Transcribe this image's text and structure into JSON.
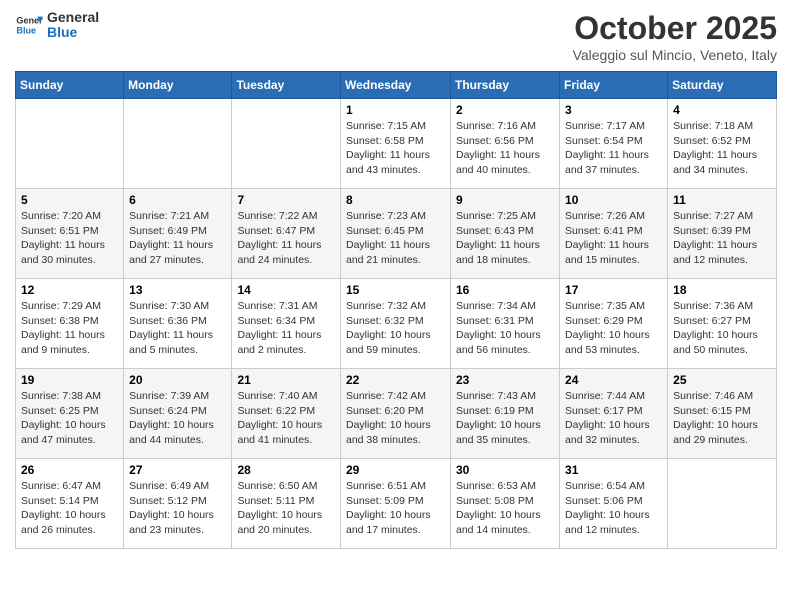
{
  "header": {
    "logo_general": "General",
    "logo_blue": "Blue",
    "month_title": "October 2025",
    "location": "Valeggio sul Mincio, Veneto, Italy"
  },
  "days_of_week": [
    "Sunday",
    "Monday",
    "Tuesday",
    "Wednesday",
    "Thursday",
    "Friday",
    "Saturday"
  ],
  "weeks": [
    [
      {
        "day": "",
        "info": ""
      },
      {
        "day": "",
        "info": ""
      },
      {
        "day": "",
        "info": ""
      },
      {
        "day": "1",
        "info": "Sunrise: 7:15 AM\nSunset: 6:58 PM\nDaylight: 11 hours and 43 minutes."
      },
      {
        "day": "2",
        "info": "Sunrise: 7:16 AM\nSunset: 6:56 PM\nDaylight: 11 hours and 40 minutes."
      },
      {
        "day": "3",
        "info": "Sunrise: 7:17 AM\nSunset: 6:54 PM\nDaylight: 11 hours and 37 minutes."
      },
      {
        "day": "4",
        "info": "Sunrise: 7:18 AM\nSunset: 6:52 PM\nDaylight: 11 hours and 34 minutes."
      }
    ],
    [
      {
        "day": "5",
        "info": "Sunrise: 7:20 AM\nSunset: 6:51 PM\nDaylight: 11 hours and 30 minutes."
      },
      {
        "day": "6",
        "info": "Sunrise: 7:21 AM\nSunset: 6:49 PM\nDaylight: 11 hours and 27 minutes."
      },
      {
        "day": "7",
        "info": "Sunrise: 7:22 AM\nSunset: 6:47 PM\nDaylight: 11 hours and 24 minutes."
      },
      {
        "day": "8",
        "info": "Sunrise: 7:23 AM\nSunset: 6:45 PM\nDaylight: 11 hours and 21 minutes."
      },
      {
        "day": "9",
        "info": "Sunrise: 7:25 AM\nSunset: 6:43 PM\nDaylight: 11 hours and 18 minutes."
      },
      {
        "day": "10",
        "info": "Sunrise: 7:26 AM\nSunset: 6:41 PM\nDaylight: 11 hours and 15 minutes."
      },
      {
        "day": "11",
        "info": "Sunrise: 7:27 AM\nSunset: 6:39 PM\nDaylight: 11 hours and 12 minutes."
      }
    ],
    [
      {
        "day": "12",
        "info": "Sunrise: 7:29 AM\nSunset: 6:38 PM\nDaylight: 11 hours and 9 minutes."
      },
      {
        "day": "13",
        "info": "Sunrise: 7:30 AM\nSunset: 6:36 PM\nDaylight: 11 hours and 5 minutes."
      },
      {
        "day": "14",
        "info": "Sunrise: 7:31 AM\nSunset: 6:34 PM\nDaylight: 11 hours and 2 minutes."
      },
      {
        "day": "15",
        "info": "Sunrise: 7:32 AM\nSunset: 6:32 PM\nDaylight: 10 hours and 59 minutes."
      },
      {
        "day": "16",
        "info": "Sunrise: 7:34 AM\nSunset: 6:31 PM\nDaylight: 10 hours and 56 minutes."
      },
      {
        "day": "17",
        "info": "Sunrise: 7:35 AM\nSunset: 6:29 PM\nDaylight: 10 hours and 53 minutes."
      },
      {
        "day": "18",
        "info": "Sunrise: 7:36 AM\nSunset: 6:27 PM\nDaylight: 10 hours and 50 minutes."
      }
    ],
    [
      {
        "day": "19",
        "info": "Sunrise: 7:38 AM\nSunset: 6:25 PM\nDaylight: 10 hours and 47 minutes."
      },
      {
        "day": "20",
        "info": "Sunrise: 7:39 AM\nSunset: 6:24 PM\nDaylight: 10 hours and 44 minutes."
      },
      {
        "day": "21",
        "info": "Sunrise: 7:40 AM\nSunset: 6:22 PM\nDaylight: 10 hours and 41 minutes."
      },
      {
        "day": "22",
        "info": "Sunrise: 7:42 AM\nSunset: 6:20 PM\nDaylight: 10 hours and 38 minutes."
      },
      {
        "day": "23",
        "info": "Sunrise: 7:43 AM\nSunset: 6:19 PM\nDaylight: 10 hours and 35 minutes."
      },
      {
        "day": "24",
        "info": "Sunrise: 7:44 AM\nSunset: 6:17 PM\nDaylight: 10 hours and 32 minutes."
      },
      {
        "day": "25",
        "info": "Sunrise: 7:46 AM\nSunset: 6:15 PM\nDaylight: 10 hours and 29 minutes."
      }
    ],
    [
      {
        "day": "26",
        "info": "Sunrise: 6:47 AM\nSunset: 5:14 PM\nDaylight: 10 hours and 26 minutes."
      },
      {
        "day": "27",
        "info": "Sunrise: 6:49 AM\nSunset: 5:12 PM\nDaylight: 10 hours and 23 minutes."
      },
      {
        "day": "28",
        "info": "Sunrise: 6:50 AM\nSunset: 5:11 PM\nDaylight: 10 hours and 20 minutes."
      },
      {
        "day": "29",
        "info": "Sunrise: 6:51 AM\nSunset: 5:09 PM\nDaylight: 10 hours and 17 minutes."
      },
      {
        "day": "30",
        "info": "Sunrise: 6:53 AM\nSunset: 5:08 PM\nDaylight: 10 hours and 14 minutes."
      },
      {
        "day": "31",
        "info": "Sunrise: 6:54 AM\nSunset: 5:06 PM\nDaylight: 10 hours and 12 minutes."
      },
      {
        "day": "",
        "info": ""
      }
    ]
  ]
}
